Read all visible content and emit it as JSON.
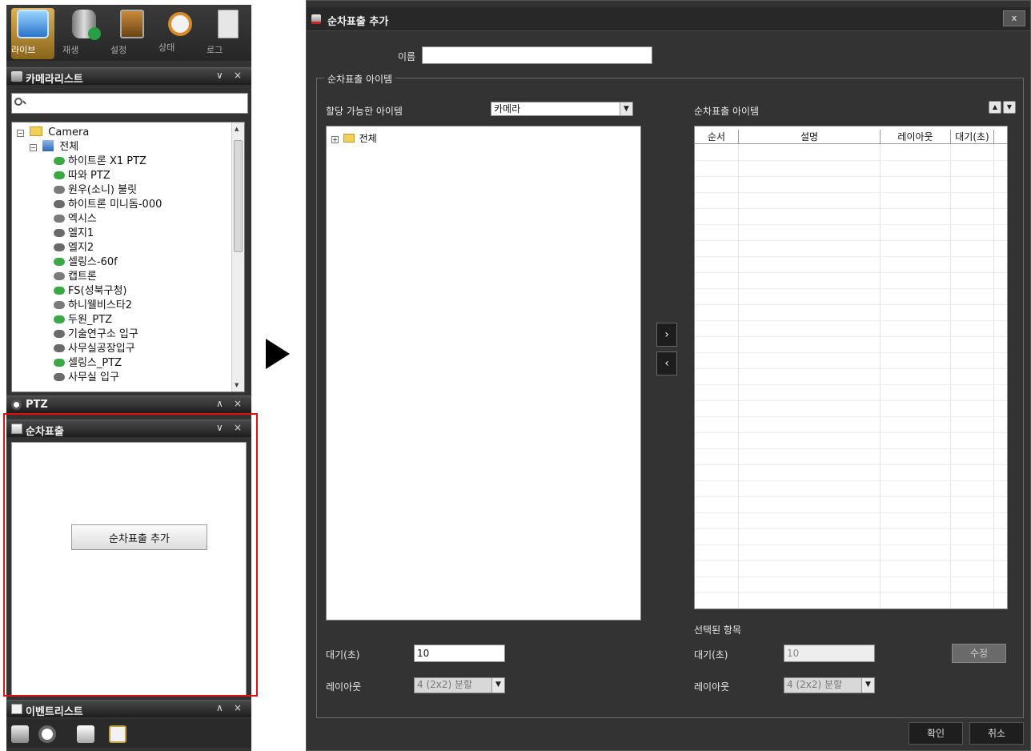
{
  "toolbar": {
    "items": [
      {
        "label": "라이브",
        "icon": "monitor-icon"
      },
      {
        "label": "재생",
        "icon": "database-play-icon"
      },
      {
        "label": "설정",
        "icon": "settings-box-icon"
      },
      {
        "label": "상태",
        "icon": "clock-icon"
      },
      {
        "label": "로그",
        "icon": "log-search-icon"
      }
    ]
  },
  "camera_list": {
    "title": "카메라리스트",
    "root": "Camera",
    "group": "전체",
    "cameras": [
      "하이트론 X1 PTZ",
      "따와 PTZ",
      "원우(소니) 불릿",
      "하이트론 미니돔-000",
      "엑시스",
      "엘지1",
      "엘지2",
      "셀링스-60f",
      "캡트론",
      "FS(성북구청)",
      "하니웰비스타2",
      "두원_PTZ",
      "기술연구소 입구",
      "사무실공장입구",
      "셀링스_PTZ",
      "사무실 입구"
    ]
  },
  "ptz": {
    "title": "PTZ"
  },
  "sequence": {
    "title": "순차표출",
    "add_button": "순차표출 추가"
  },
  "event_list": {
    "title": "이벤트리스트"
  },
  "dialog": {
    "title": "순차표출 추가",
    "close": "x",
    "name_label": "이름",
    "name_value": "",
    "group_label": "순차표출 아이템",
    "available_label": "할당 가능한 아이템",
    "available_type": "카메라",
    "available_root": "전체",
    "seq_items_label": "순차표출 아이템",
    "columns": [
      "순서",
      "설명",
      "레이아웃",
      "대기(초)"
    ],
    "wait_label": "대기(초)",
    "wait_value": "10",
    "layout_label": "레이아웃",
    "layout_value": "4 (2x2) 분할",
    "selected_label": "선택된 항목",
    "sel_wait_label": "대기(초)",
    "sel_wait_value": "10",
    "sel_layout_label": "레이아웃",
    "sel_layout_value": "4 (2x2) 분할",
    "edit_button": "수정",
    "ok_button": "확인",
    "cancel_button": "취소",
    "move_right": "›",
    "move_left": "‹"
  },
  "colors": {
    "accent": "#d9b25a",
    "highlight": "#e01010",
    "panel": "#333333"
  }
}
